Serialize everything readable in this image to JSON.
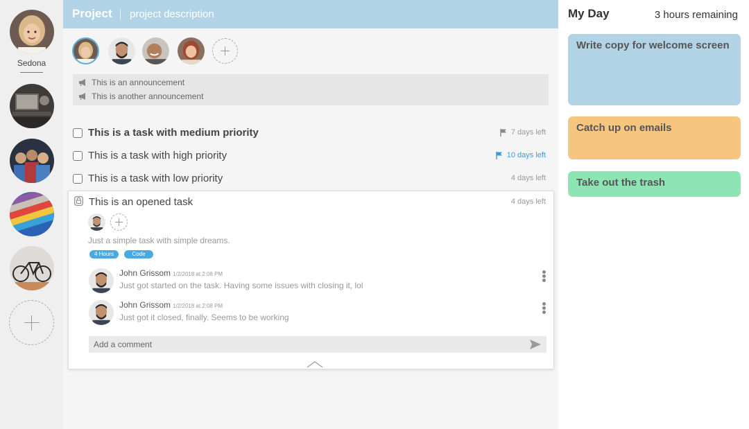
{
  "sidebar": {
    "user_name": "Sedona",
    "projects": [
      {
        "icon": "laptop-desk-photo"
      },
      {
        "icon": "team-photo"
      },
      {
        "icon": "color-swatches-photo"
      },
      {
        "icon": "bicycle-photo"
      }
    ]
  },
  "header": {
    "title": "Project",
    "description": "project description",
    "color": "#b2d3e6"
  },
  "members": [
    {
      "name": "member-woman-blonde",
      "active": true
    },
    {
      "name": "member-man-beard"
    },
    {
      "name": "member-man-laughing"
    },
    {
      "name": "member-woman-red"
    }
  ],
  "announcements": [
    {
      "text": "This is an announcement",
      "icon": "megaphone-icon"
    },
    {
      "text": "This is another announcement",
      "icon": "megaphone-icon"
    }
  ],
  "tasks": [
    {
      "title": "This is a task with medium priority",
      "due": "7 days left",
      "flag": true,
      "flag_color": "#888888"
    },
    {
      "title": "This is a task with high priority",
      "due": "10 days left",
      "flag": true,
      "flag_color": "#3a9ad9"
    },
    {
      "title": "This is a task with low priority",
      "due": "4 days left",
      "flag": false
    }
  ],
  "opened_task": {
    "title": "This is an opened task",
    "due": "4 days left",
    "description": "Just a simple task with simple dreams.",
    "tags": [
      "4 Hours",
      "Code"
    ],
    "comments": [
      {
        "author": "John Grissom",
        "time": "1/2/2018 at 2:08 PM",
        "text": "Just got started on the task. Having some issues with closing it, lol"
      },
      {
        "author": "John Grissom",
        "time": "1/2/2018 at 2:08 PM",
        "text": "Just got it closed, finally. Seems to be working"
      }
    ],
    "comment_placeholder": "Add a comment"
  },
  "my_day": {
    "title": "My Day",
    "remaining": "3 hours remaining",
    "cards": [
      {
        "text": "Write copy for welcome screen",
        "color": "#b2d3e6"
      },
      {
        "text": "Catch up on emails",
        "color": "#f7c67e"
      },
      {
        "text": "Take out the trash",
        "color": "#8de5b4"
      }
    ]
  }
}
